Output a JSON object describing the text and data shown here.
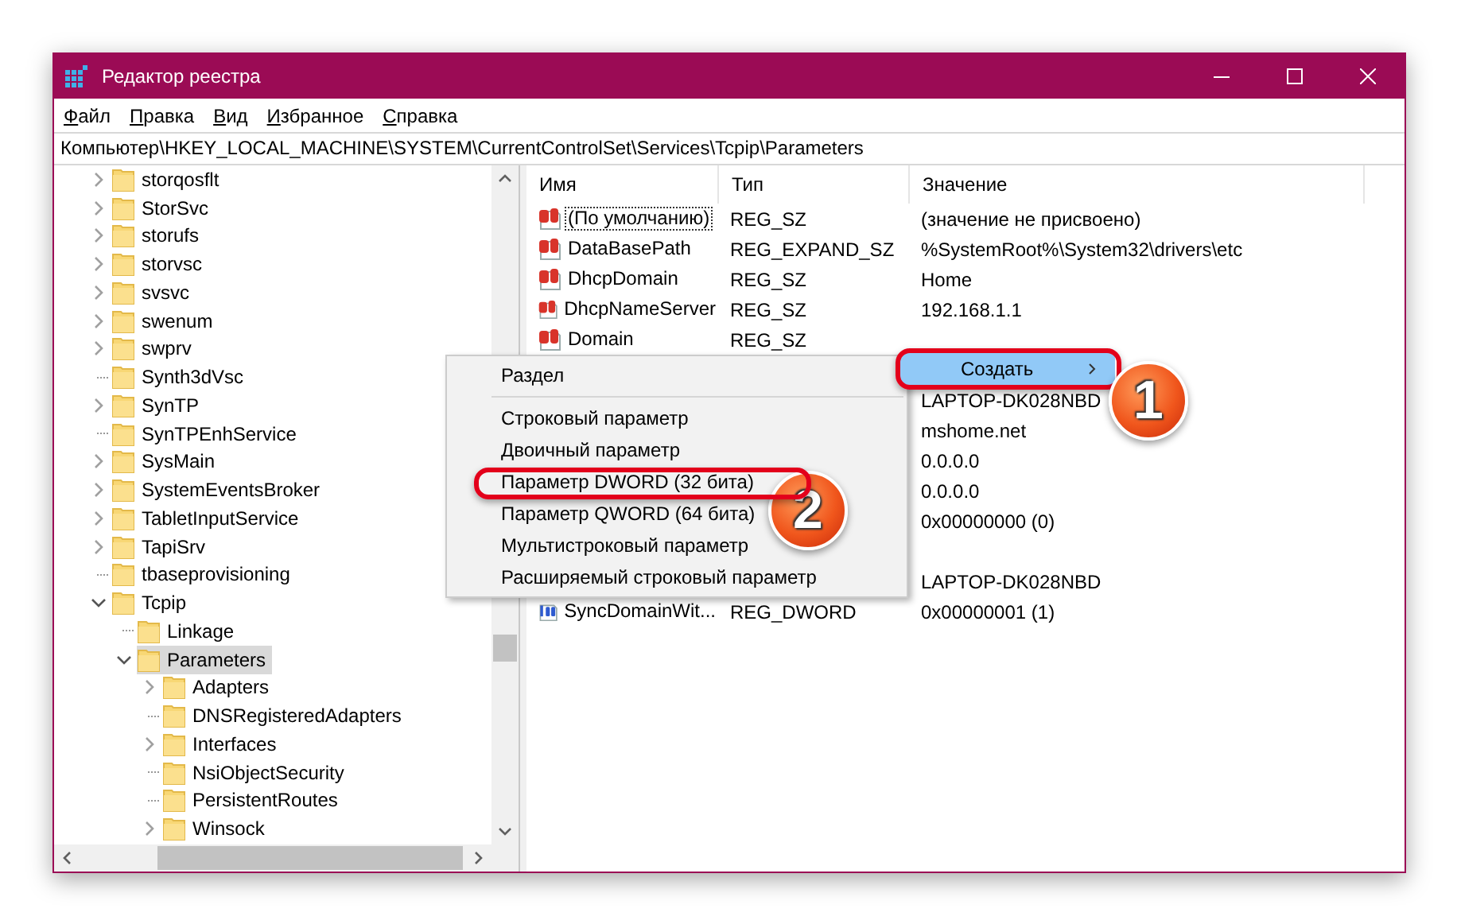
{
  "window": {
    "title": "Редактор реестра"
  },
  "menu_bar": [
    "Файл",
    "Правка",
    "Вид",
    "Избранное",
    "Справка"
  ],
  "address": "Компьютер\\HKEY_LOCAL_MACHINE\\SYSTEM\\CurrentControlSet\\Services\\Tcpip\\Parameters",
  "tree": [
    {
      "label": "storqosflt",
      "kind": "branch",
      "expanded": false,
      "selected": false
    },
    {
      "label": "StorSvc",
      "kind": "branch",
      "expanded": false,
      "selected": false
    },
    {
      "label": "storufs",
      "kind": "branch",
      "expanded": false,
      "selected": false
    },
    {
      "label": "storvsc",
      "kind": "branch",
      "expanded": false,
      "selected": false
    },
    {
      "label": "svsvc",
      "kind": "branch",
      "expanded": false,
      "selected": false
    },
    {
      "label": "swenum",
      "kind": "branch",
      "expanded": false,
      "selected": false
    },
    {
      "label": "swprv",
      "kind": "branch",
      "expanded": false,
      "selected": false
    },
    {
      "label": "Synth3dVsc",
      "kind": "leaf",
      "selected": false
    },
    {
      "label": "SynTP",
      "kind": "branch",
      "expanded": false,
      "selected": false
    },
    {
      "label": "SynTPEnhService",
      "kind": "leaf",
      "selected": false
    },
    {
      "label": "SysMain",
      "kind": "branch",
      "expanded": false,
      "selected": false
    },
    {
      "label": "SystemEventsBroker",
      "kind": "branch",
      "expanded": false,
      "selected": false
    },
    {
      "label": "TabletInputService",
      "kind": "branch",
      "expanded": false,
      "selected": false
    },
    {
      "label": "TapiSrv",
      "kind": "branch",
      "expanded": false,
      "selected": false
    },
    {
      "label": "tbaseprovisioning",
      "kind": "leaf",
      "selected": false
    },
    {
      "label": "Tcpip",
      "kind": "branch",
      "expanded": true,
      "selected": false,
      "children": [
        {
          "label": "Linkage",
          "kind": "leaf",
          "selected": false
        },
        {
          "label": "Parameters",
          "kind": "branch",
          "expanded": true,
          "selected": true,
          "children": [
            {
              "label": "Adapters",
              "kind": "branch",
              "expanded": false,
              "selected": false
            },
            {
              "label": "DNSRegisteredAdapters",
              "kind": "leaf",
              "selected": false
            },
            {
              "label": "Interfaces",
              "kind": "branch",
              "expanded": false,
              "selected": false
            },
            {
              "label": "NsiObjectSecurity",
              "kind": "leaf",
              "selected": false
            },
            {
              "label": "PersistentRoutes",
              "kind": "leaf",
              "selected": false
            },
            {
              "label": "Winsock",
              "kind": "branch",
              "expanded": false,
              "selected": false
            }
          ]
        }
      ]
    }
  ],
  "table": {
    "columns": [
      "Имя",
      "Тип",
      "Значение"
    ],
    "rows": [
      {
        "name": "(По умолчанию)",
        "type": "REG_SZ",
        "value": "(значение не присвоено)",
        "kind": "string",
        "focused": true
      },
      {
        "name": "DataBasePath",
        "type": "REG_EXPAND_SZ",
        "value": "%SystemRoot%\\System32\\drivers\\etc",
        "kind": "string",
        "focused": false
      },
      {
        "name": "DhcpDomain",
        "type": "REG_SZ",
        "value": "Home",
        "kind": "string",
        "focused": false
      },
      {
        "name": "DhcpNameServer",
        "type": "REG_SZ",
        "value": "192.168.1.1",
        "kind": "string",
        "focused": false
      },
      {
        "name": "Domain",
        "type": "REG_SZ",
        "kind": "string",
        "focused": false
      },
      {},
      {
        "value": "LAPTOP-DK028NBD"
      },
      {
        "value": "mshome.net"
      },
      {
        "value": "0.0.0.0"
      },
      {
        "value": "0.0.0.0"
      },
      {
        "value": "0x00000000 (0)"
      },
      {},
      {
        "value": "LAPTOP-DK028NBD"
      },
      {
        "name": "SyncDomainWit...",
        "type": "REG_DWORD",
        "value": "0x00000001 (1)",
        "kind": "dword",
        "focused": false
      }
    ]
  },
  "context_menu": {
    "parent_item": {
      "label": "Создать",
      "highlighted": true
    },
    "groups": [
      [
        "Раздел"
      ],
      [
        "Строковый параметр",
        "Двоичный параметр",
        "Параметр DWORD (32 бита)",
        "Параметр QWORD (64 бита)",
        "Мультистроковый параметр",
        "Расширяемый строковый параметр"
      ]
    ]
  },
  "annotations": [
    {
      "number": "1"
    },
    {
      "number": "2"
    }
  ]
}
